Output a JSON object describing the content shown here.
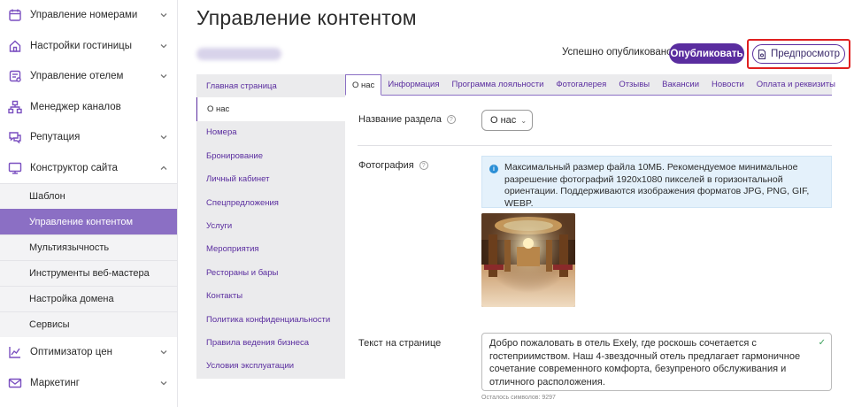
{
  "sidebar": {
    "items": [
      {
        "label": "Управление номерами",
        "icon": "calendar-icon"
      },
      {
        "label": "Настройки гостиницы",
        "icon": "home-icon"
      },
      {
        "label": "Управление отелем",
        "icon": "hotel-icon"
      },
      {
        "label": "Менеджер каналов",
        "icon": "hierarchy-icon"
      },
      {
        "label": "Репутация",
        "icon": "chat-icon"
      },
      {
        "label": "Конструктор сайта",
        "icon": "monitor-icon"
      }
    ],
    "subitems": [
      {
        "label": "Шаблон"
      },
      {
        "label": "Управление контентом"
      },
      {
        "label": "Мультиязычность"
      },
      {
        "label": "Инструменты веб-мастера"
      },
      {
        "label": "Настройка домена"
      },
      {
        "label": "Сервисы"
      }
    ],
    "bottom_items": [
      {
        "label": "Оптимизатор цен",
        "icon": "chart-icon"
      },
      {
        "label": "Маркетинг",
        "icon": "mail-icon"
      }
    ]
  },
  "header": {
    "title": "Управление контентом",
    "status": "Успешно опубликовано",
    "publish_label": "Опубликовать",
    "preview_label": "Предпросмотр"
  },
  "section_nav": {
    "items": [
      {
        "label": "Главная страница"
      },
      {
        "label": "О нас"
      },
      {
        "label": "Номера"
      },
      {
        "label": "Бронирование"
      },
      {
        "label": "Личный кабинет"
      },
      {
        "label": "Спецпредложения"
      },
      {
        "label": "Услуги"
      },
      {
        "label": "Мероприятия"
      },
      {
        "label": "Рестораны и бары"
      },
      {
        "label": "Контакты"
      },
      {
        "label": "Политика конфиденциальности"
      },
      {
        "label": "Правила ведения бизнеса"
      },
      {
        "label": "Условия эксплуатации"
      }
    ]
  },
  "tabs": [
    {
      "label": "О нас"
    },
    {
      "label": "Информация"
    },
    {
      "label": "Программа лояльности"
    },
    {
      "label": "Фотогалерея"
    },
    {
      "label": "Отзывы"
    },
    {
      "label": "Вакансии"
    },
    {
      "label": "Новости"
    },
    {
      "label": "Оплата и реквизиты"
    }
  ],
  "form": {
    "section_name_label": "Название раздела",
    "section_name_value": "О нас",
    "photo_label": "Фотография",
    "photo_info": "Максимальный размер файла 10МБ. Рекомендуемое минимальное разрешение фотографий 1920х1080 пикселей в горизонтальной ориентации. Поддерживаются изображения форматов JPG, PNG, GIF, WEBP.",
    "text_label": "Текст на странице",
    "text_value": "Добро пожаловать в отель Exely, где роскошь сочетается с гостеприимством. Наш 4-звездочный отель предлагает гармоничное сочетание современного комфорта, безупреного обслуживания и отличного расположения.",
    "char_count": "Осталось символов: 9297"
  },
  "colors": {
    "accent": "#5a2d9f",
    "active_bg": "#8b6fc4",
    "highlight": "#e02020"
  }
}
